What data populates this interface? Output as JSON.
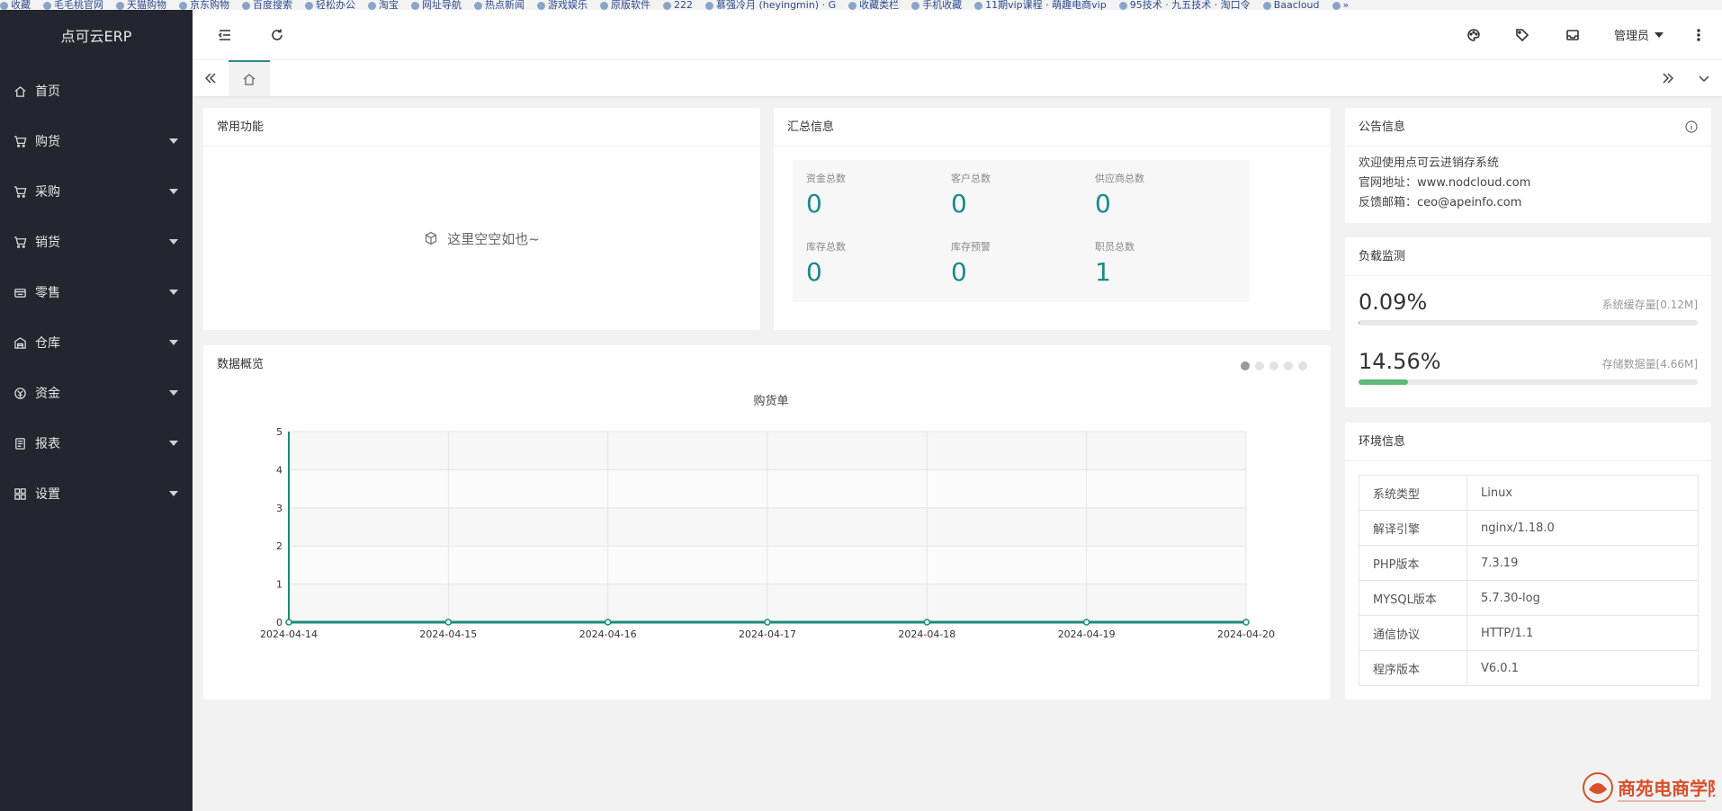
{
  "bookmarks": [
    "收藏",
    "毛毛桃官网",
    "天猫购物",
    "京东购物",
    "百度搜索",
    "轻松办公",
    "淘宝",
    "网址导航",
    "热点新闻",
    "游戏娱乐",
    "原版软件",
    "222",
    "慕强冷月 (heyingmin) · G",
    "收藏类栏",
    "手机收藏",
    "11期vip课程 · 萌趣电商vip",
    "95技术 · 九五技术 · 淘口令",
    "Baacloud",
    "»"
  ],
  "sidebar": {
    "brand": "点可云ERP",
    "items": [
      {
        "label": "首页",
        "icon": "home-icon",
        "has_caret": false
      },
      {
        "label": "购货",
        "icon": "cart-icon",
        "has_caret": true
      },
      {
        "label": "采购",
        "icon": "cart-icon",
        "has_caret": true
      },
      {
        "label": "销货",
        "icon": "cart-icon",
        "has_caret": true
      },
      {
        "label": "零售",
        "icon": "store-icon",
        "has_caret": true
      },
      {
        "label": "仓库",
        "icon": "warehouse-icon",
        "has_caret": true
      },
      {
        "label": "资金",
        "icon": "money-icon",
        "has_caret": true
      },
      {
        "label": "报表",
        "icon": "report-icon",
        "has_caret": true
      },
      {
        "label": "设置",
        "icon": "grid-icon",
        "has_caret": true
      }
    ]
  },
  "header": {
    "user": "管理员",
    "icons": [
      "menu-fold-icon",
      "refresh-icon",
      "palette-icon",
      "tag-icon",
      "inbox-icon",
      "more-icon"
    ]
  },
  "common_functions": {
    "title": "常用功能",
    "empty_text": "这里空空如也~"
  },
  "summary": {
    "title": "汇总信息",
    "stats": [
      {
        "label": "资金总数",
        "value": "0"
      },
      {
        "label": "客户总数",
        "value": "0"
      },
      {
        "label": "供应商总数",
        "value": "0"
      },
      {
        "label": "库存总数",
        "value": "0"
      },
      {
        "label": "库存预警",
        "value": "0"
      },
      {
        "label": "职员总数",
        "value": "1"
      }
    ]
  },
  "notice": {
    "title": "公告信息",
    "lines": [
      "欢迎使用点可云进销存系统",
      "官网地址：www.nodcloud.com",
      "反馈邮箱：ceo@apeinfo.com"
    ]
  },
  "load": {
    "title": "负载监测",
    "rows": [
      {
        "percent": "0.09%",
        "fraction": 0.0009,
        "desc": "系统缓存量[0.12M]"
      },
      {
        "percent": "14.56%",
        "fraction": 0.1456,
        "desc": "存储数据量[4.66M]"
      }
    ]
  },
  "env": {
    "title": "环境信息",
    "rows": [
      {
        "key": "系统类型",
        "value": "Linux"
      },
      {
        "key": "解译引擎",
        "value": "nginx/1.18.0"
      },
      {
        "key": "PHP版本",
        "value": "7.3.19"
      },
      {
        "key": "MYSQL版本",
        "value": "5.7.30-log"
      },
      {
        "key": "通信协议",
        "value": "HTTP/1.1"
      },
      {
        "key": "程序版本",
        "value": "V6.0.1"
      }
    ]
  },
  "overview": {
    "title": "数据概览",
    "pages": 5,
    "active_page": 0
  },
  "chart_data": {
    "type": "line",
    "title": "购货单",
    "x": [
      "2024-04-14",
      "2024-04-15",
      "2024-04-16",
      "2024-04-17",
      "2024-04-18",
      "2024-04-19",
      "2024-04-20"
    ],
    "series": [
      {
        "values": [
          0,
          0,
          0,
          0,
          0,
          0,
          0
        ]
      }
    ],
    "ylim": [
      0,
      5
    ],
    "yticks": [
      "0",
      "1",
      "2",
      "3",
      "4",
      "5"
    ],
    "grid": true,
    "color": "#1b8a7a"
  },
  "watermark": {
    "text": "商苑电商学院"
  }
}
